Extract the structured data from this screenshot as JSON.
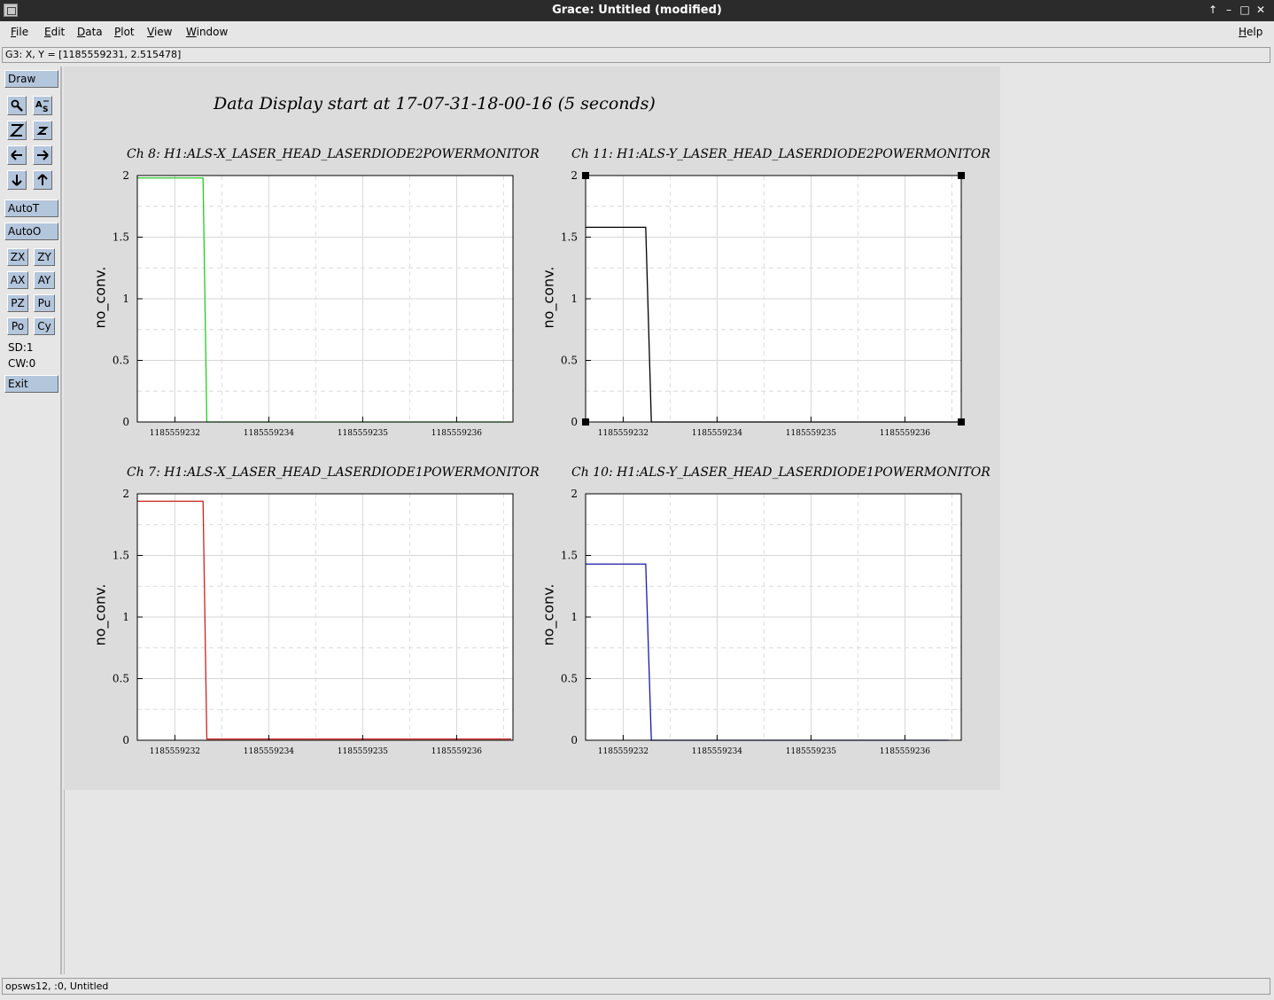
{
  "window": {
    "title": "Grace: Untitled (modified)",
    "controls": [
      "↑",
      "–",
      "□",
      "✕"
    ]
  },
  "menu": {
    "items": [
      "File",
      "Edit",
      "Data",
      "Plot",
      "View",
      "Window"
    ],
    "help": "Help"
  },
  "locator": "G3: X, Y = [1185559231, 2.515478]",
  "toolbar": {
    "draw": "Draw",
    "autot": "AutoT",
    "autoo": "AutoO",
    "zx": "ZX",
    "zy": "ZY",
    "ax": "AX",
    "ay": "AY",
    "pz": "PZ",
    "pu": "Pu",
    "po": "Po",
    "cy": "Cy",
    "sd": "SD:1",
    "cw": "CW:0",
    "exit": "Exit",
    "icons": [
      "zoom-icon",
      "autoscale-icon",
      "zoom-in-icon",
      "zoom-out-icon",
      "scroll-left-icon",
      "scroll-right-icon",
      "scroll-down-icon",
      "scroll-up-icon"
    ]
  },
  "sheet": {
    "title": "Data Display start at 17-07-31-18-00-16 (5 seconds)"
  },
  "chart_data": [
    {
      "type": "line",
      "title": "Ch 8: H1:ALS-X_LASER_HEAD_LASERDIODE2POWERMONITOR",
      "ylabel": "no_conv.",
      "xlabel": "",
      "x_ticks": [
        "1185559232",
        "1185559234",
        "1185559235",
        "1185559236"
      ],
      "y_ticks": [
        "0",
        "0.5",
        "1",
        "1.5",
        "2"
      ],
      "ylim": [
        0,
        2
      ],
      "color": "#22cc22",
      "selected": false,
      "series": [
        {
          "x": [
            0,
            0.175,
            0.185,
            0.995
          ],
          "y": [
            1.98,
            1.98,
            0.0,
            0.0
          ]
        }
      ]
    },
    {
      "type": "line",
      "title": "Ch 11: H1:ALS-Y_LASER_HEAD_LASERDIODE2POWERMONITOR",
      "ylabel": "no_conv.",
      "xlabel": "",
      "x_ticks": [
        "1185559232",
        "1185559234",
        "1185559235",
        "1185559236"
      ],
      "y_ticks": [
        "0",
        "0.5",
        "1",
        "1.5",
        "2"
      ],
      "ylim": [
        0,
        2
      ],
      "color": "#000000",
      "selected": true,
      "series": [
        {
          "x": [
            0,
            0.16,
            0.175,
            0.995
          ],
          "y": [
            1.58,
            1.58,
            0.0,
            0.0
          ]
        }
      ]
    },
    {
      "type": "line",
      "title": "Ch 7: H1:ALS-X_LASER_HEAD_LASERDIODE1POWERMONITOR",
      "ylabel": "no_conv.",
      "xlabel": "",
      "x_ticks": [
        "1185559232",
        "1185559234",
        "1185559235",
        "1185559236"
      ],
      "y_ticks": [
        "0",
        "0.5",
        "1",
        "1.5",
        "2"
      ],
      "ylim": [
        0,
        2
      ],
      "color": "#cc2222",
      "selected": false,
      "series": [
        {
          "x": [
            0,
            0.175,
            0.185,
            0.995
          ],
          "y": [
            1.94,
            1.94,
            0.01,
            0.01
          ]
        }
      ]
    },
    {
      "type": "line",
      "title": "Ch 10: H1:ALS-Y_LASER_HEAD_LASERDIODE1POWERMONITOR",
      "ylabel": "no_conv.",
      "xlabel": "",
      "x_ticks": [
        "1185559232",
        "1185559234",
        "1185559235",
        "1185559236"
      ],
      "y_ticks": [
        "0",
        "0.5",
        "1",
        "1.5",
        "2"
      ],
      "ylim": [
        0,
        2
      ],
      "color": "#1a1aaa",
      "selected": false,
      "series": [
        {
          "x": [
            0,
            0.16,
            0.175,
            0.965
          ],
          "y": [
            1.43,
            1.43,
            0.0,
            0.0
          ]
        }
      ]
    }
  ],
  "status": "opsws12, :0, Untitled"
}
